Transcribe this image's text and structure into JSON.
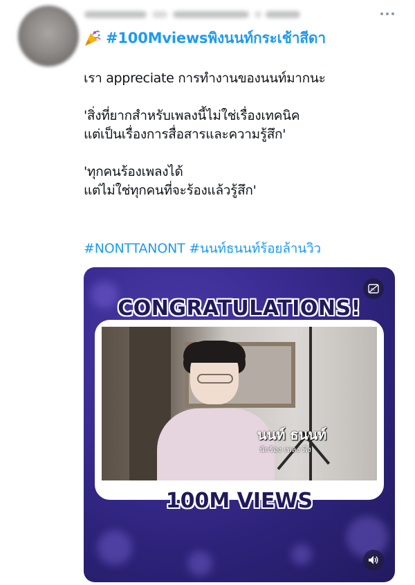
{
  "tweet": {
    "title_hashtag": "#100Mviewsพิงนนท์กระเช้าสีดา",
    "lines": [
      "เรา appreciate การทำงานของนนท์มากนะ",
      "'สิ่งที่ยากสำหรับเพลงนี้ไม่ใช่เรื่องเทคนิค",
      "แต่เป็นเรื่องการสื่อสารและความรู้สึก'",
      "'ทุกคนร้องเพลงได้",
      "แต่ไม่ใช่ทุกคนที่จะร้องแล้วรู้สึก'"
    ],
    "tags": [
      "#NONTTANONT",
      "#นนท์ธนนท์ร้อยล้านวิว"
    ]
  },
  "media": {
    "banner_top": "CONGRATULATIONS!",
    "banner_bottom": "100M VIEWS",
    "lower_third_name": "นนท์ ธนนท์",
    "lower_third_sub": "นักร้อง เพลง พิง"
  },
  "icons": {
    "more": "more-dots-icon",
    "party": "party-popper-icon",
    "captions": "captions-icon",
    "volume": "volume-icon"
  },
  "colors": {
    "link": "#1d9bf0",
    "text": "#0f1419",
    "media_bg": "#3b2c93",
    "banner_text": "#1e1a5a"
  }
}
